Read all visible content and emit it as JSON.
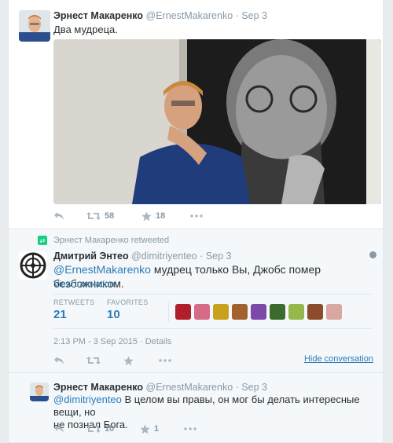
{
  "tweet1": {
    "name": "Эрнест Макаренко",
    "handle": "@ErnestMakarenko",
    "sep": "·",
    "time": "Sep 3",
    "text": "Два мудреца.",
    "retweets": "58",
    "favorites": "18"
  },
  "tweet2": {
    "retweeted_by": "Эрнест Макаренко retweeted",
    "name": "Дмитрий Энтео",
    "handle": "@dimitriyenteo",
    "sep": "·",
    "time": "Sep 3",
    "mention": "@ErnestMakarenko",
    "text": " мудрец только Вы, Джобс помер безбожником.",
    "translate": "View translation",
    "retweets_label": "RETWEETS",
    "retweets_value": "21",
    "favorites_label": "FAVORITES",
    "favorites_value": "10",
    "stamp": "2:13 PM - 3 Sep 2015 · Details",
    "hide": "Hide conversation",
    "face_colors": [
      "#b1202a",
      "#d66b88",
      "#c8a21c",
      "#a2622e",
      "#7b4aa8",
      "#3d6b2d",
      "#95b84a",
      "#8b4c2c",
      "#d8a7a0"
    ]
  },
  "tweet3": {
    "name": "Эрнест Макаренко",
    "handle": "@ErnestMakarenko",
    "sep": "·",
    "time": "Sep 3",
    "mention": "@dimitriyenteo",
    "text_line1": " В целом вы правы, он мог бы делать интересные вещи, но",
    "text_line2": "не познал Бога.",
    "retweets": "10",
    "favorites": "1"
  },
  "icons": {
    "reply": "reply-icon",
    "retweet": "retweet-icon",
    "favorite": "star-icon",
    "more": "more-icon"
  }
}
